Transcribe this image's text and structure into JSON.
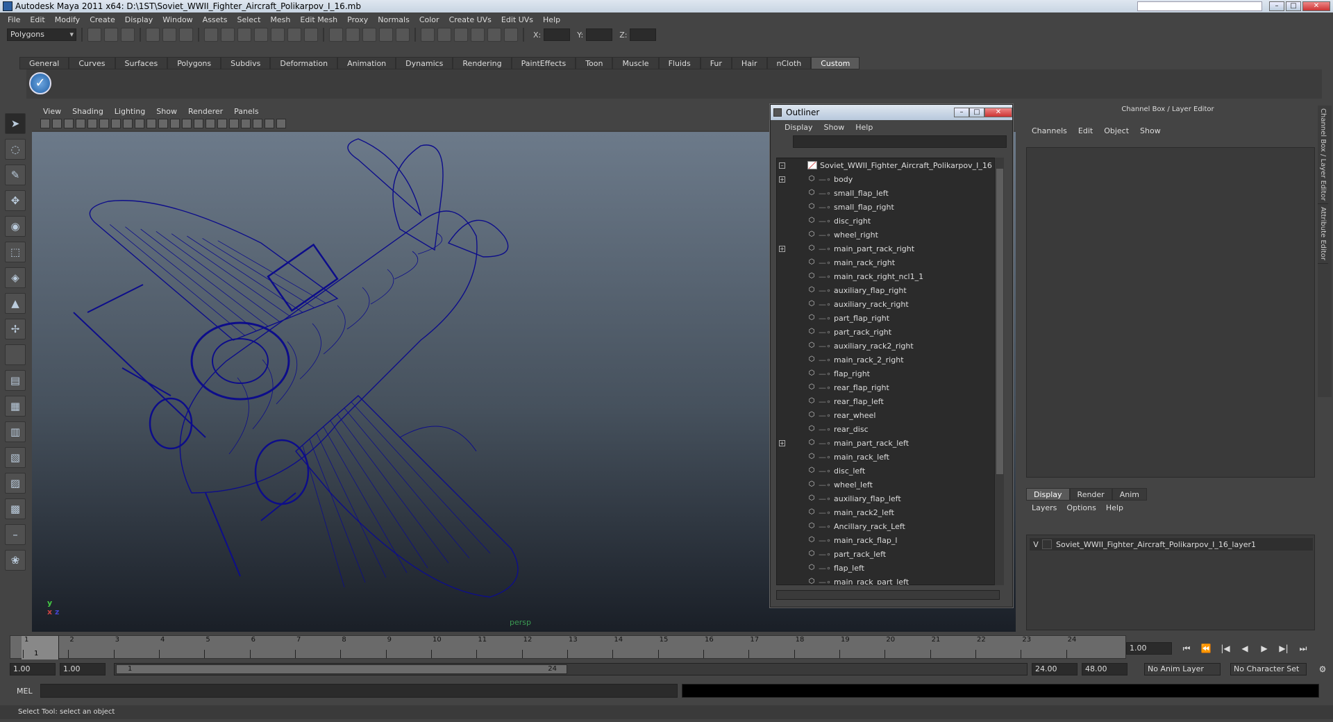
{
  "window": {
    "title": "Autodesk Maya 2011 x64: D:\\1ST\\Soviet_WWII_Fighter_Aircraft_Polikarpov_I_16.mb"
  },
  "menubar": [
    "File",
    "Edit",
    "Modify",
    "Create",
    "Display",
    "Window",
    "Assets",
    "Select",
    "Mesh",
    "Edit Mesh",
    "Proxy",
    "Normals",
    "Color",
    "Create UVs",
    "Edit UVs",
    "Help"
  ],
  "statusline": {
    "mode": "Polygons",
    "x_label": "X:",
    "y_label": "Y:",
    "z_label": "Z:"
  },
  "shelf": {
    "tabs": [
      "General",
      "Curves",
      "Surfaces",
      "Polygons",
      "Subdivs",
      "Deformation",
      "Animation",
      "Dynamics",
      "Rendering",
      "PaintEffects",
      "Toon",
      "Muscle",
      "Fluids",
      "Fur",
      "Hair",
      "nCloth",
      "Custom"
    ],
    "active_tab": "Custom"
  },
  "viewport": {
    "menus": [
      "View",
      "Shading",
      "Lighting",
      "Show",
      "Renderer",
      "Panels"
    ],
    "camera": "persp",
    "wire_color": "#0d0d8a"
  },
  "outliner": {
    "title": "Outliner",
    "menus": [
      "Display",
      "Show",
      "Help"
    ],
    "root": "Soviet_WWII_Fighter_Aircraft_Polikarpov_I_16",
    "items": [
      {
        "name": "body",
        "expandable": true
      },
      {
        "name": "small_flap_left",
        "expandable": false
      },
      {
        "name": "small_flap_right",
        "expandable": false
      },
      {
        "name": "disc_right",
        "expandable": false
      },
      {
        "name": "wheel_right",
        "expandable": false
      },
      {
        "name": "main_part_rack_right",
        "expandable": true
      },
      {
        "name": "main_rack_right",
        "expandable": false
      },
      {
        "name": "main_rack_right_ncl1_1",
        "expandable": false
      },
      {
        "name": "auxiliary_flap_right",
        "expandable": false
      },
      {
        "name": "auxiliary_rack_right",
        "expandable": false
      },
      {
        "name": "part_flap_right",
        "expandable": false
      },
      {
        "name": "part_rack_right",
        "expandable": false
      },
      {
        "name": "auxiliary_rack2_right",
        "expandable": false
      },
      {
        "name": "main_rack_2_right",
        "expandable": false
      },
      {
        "name": "flap_right",
        "expandable": false
      },
      {
        "name": "rear_flap_right",
        "expandable": false
      },
      {
        "name": "rear_flap_left",
        "expandable": false
      },
      {
        "name": "rear_wheel",
        "expandable": false
      },
      {
        "name": "rear_disc",
        "expandable": false
      },
      {
        "name": "main_part_rack_left",
        "expandable": true
      },
      {
        "name": "main_rack_left",
        "expandable": false
      },
      {
        "name": "disc_left",
        "expandable": false
      },
      {
        "name": "wheel_left",
        "expandable": false
      },
      {
        "name": "auxiliary_flap_left",
        "expandable": false
      },
      {
        "name": "main_rack2_left",
        "expandable": false
      },
      {
        "name": "Ancillary_rack_Left",
        "expandable": false
      },
      {
        "name": "main_rack_flap_l",
        "expandable": false
      },
      {
        "name": "part_rack_left",
        "expandable": false
      },
      {
        "name": "flap_left",
        "expandable": false
      },
      {
        "name": "main_rack_part_left",
        "expandable": false
      }
    ]
  },
  "channelbox": {
    "title": "Channel Box / Layer Editor",
    "menus": [
      "Channels",
      "Edit",
      "Object",
      "Show"
    ],
    "layer_tabs": [
      "Display",
      "Render",
      "Anim"
    ],
    "active_layer_tab": "Display",
    "layer_menus": [
      "Layers",
      "Options",
      "Help"
    ],
    "layer": {
      "visible": "V",
      "name": "Soviet_WWII_Fighter_Aircraft_Polikarpov_I_16_layer1"
    },
    "side_tabs": [
      "Channel Box / Layer Editor",
      "Attribute Editor"
    ]
  },
  "timeline": {
    "ticks": [
      "1",
      "2",
      "3",
      "4",
      "5",
      "6",
      "7",
      "8",
      "9",
      "10",
      "11",
      "12",
      "13",
      "14",
      "15",
      "16",
      "17",
      "18",
      "19",
      "20",
      "21",
      "22",
      "23",
      "24"
    ],
    "current_frame_marker": "1",
    "current_time": "1.00"
  },
  "range": {
    "start_time": "1.00",
    "playback_start": "1.00",
    "handle_start": "1",
    "handle_end": "24",
    "playback_end": "24.00",
    "end_time": "48.00",
    "anim_layer": "No Anim Layer",
    "character_set": "No Character Set"
  },
  "cmdline": {
    "label": "MEL"
  },
  "helpline": {
    "text": "Select Tool: select an object"
  }
}
